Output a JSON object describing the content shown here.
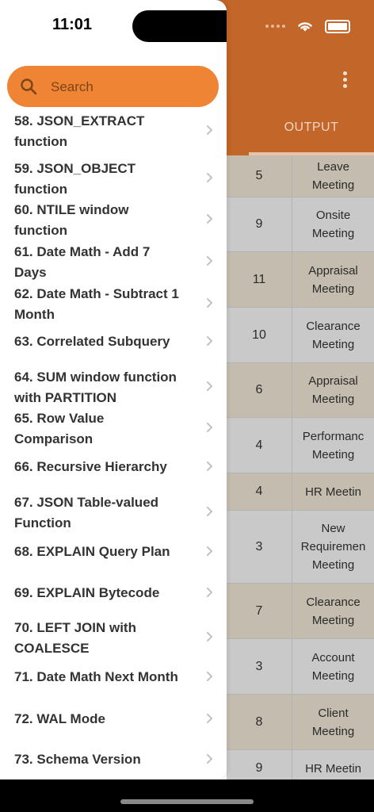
{
  "status": {
    "time": "11:01"
  },
  "header": {
    "tab_output": "OUTPUT"
  },
  "search": {
    "placeholder": "Search"
  },
  "menu": [
    {
      "label": "58. JSON_EXTRACT\nfunction"
    },
    {
      "label": "59. JSON_OBJECT\nfunction"
    },
    {
      "label": "60. NTILE window\nfunction"
    },
    {
      "label": "61. Date Math - Add 7\nDays"
    },
    {
      "label": "62. Date Math - Subtract 1\nMonth"
    },
    {
      "label": "63. Correlated Subquery"
    },
    {
      "label": "64. SUM window function\nwith PARTITION"
    },
    {
      "label": "65. Row Value\nComparison"
    },
    {
      "label": "66. Recursive Hierarchy"
    },
    {
      "label": "67. JSON Table-valued\nFunction"
    },
    {
      "label": "68. EXPLAIN Query Plan"
    },
    {
      "label": "69. EXPLAIN Bytecode"
    },
    {
      "label": "70. LEFT JOIN with\nCOALESCE"
    },
    {
      "label": "71. Date Math Next Month"
    },
    {
      "label": "72. WAL Mode"
    },
    {
      "label": "73. Schema Version"
    }
  ],
  "table": {
    "rows": [
      {
        "count": "5",
        "type": "Leave\nMeeting"
      },
      {
        "count": "9",
        "type": "Onsite\nMeeting"
      },
      {
        "count": "11",
        "type": "Appraisal\nMeeting"
      },
      {
        "count": "10",
        "type": "Clearance\nMeeting"
      },
      {
        "count": "6",
        "type": "Appraisal\nMeeting"
      },
      {
        "count": "4",
        "type": "Performanc\nMeeting"
      },
      {
        "count": "4",
        "type": "HR Meetin"
      },
      {
        "count": "3",
        "type": "New\nRequiremen\nMeeting"
      },
      {
        "count": "7",
        "type": "Clearance\nMeeting"
      },
      {
        "count": "3",
        "type": "Account\nMeeting"
      },
      {
        "count": "8",
        "type": "Client\nMeeting"
      },
      {
        "count": "9",
        "type": "HR Meetin"
      }
    ]
  },
  "colors": {
    "accent": "#ef8434",
    "header": "#c2662a"
  }
}
